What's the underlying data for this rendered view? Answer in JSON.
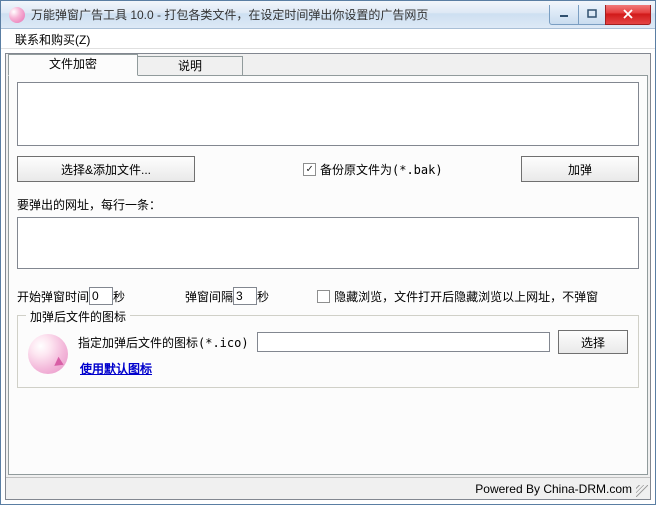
{
  "title": "万能弹窗广告工具 10.0 - 打包各类文件，在设定时间弹出你设置的广告网页",
  "menu": {
    "contact": "联系和购买(Z)"
  },
  "tabs": {
    "encrypt": "文件加密",
    "help": "说明"
  },
  "buttons": {
    "select_add": "选择&添加文件...",
    "encrypt": "加弹",
    "choose_icon": "选择"
  },
  "checkboxes": {
    "backup": {
      "label": "备份原文件为(*.bak)",
      "checked": true
    },
    "hidden_browse": {
      "label": "隐藏浏览，文件打开后隐藏浏览以上网址，不弹窗",
      "checked": false
    }
  },
  "labels": {
    "urls": "要弹出的网址，每行一条：",
    "start_time_pre": "开始弹窗时间",
    "seconds": "秒",
    "interval_pre": "弹窗间隔",
    "group_title": "加弹后文件的图标",
    "icon_spec": "指定加弹后文件的图标(*.ico)"
  },
  "inputs": {
    "top_text": "",
    "urls_text": "",
    "start_time": "0",
    "interval": "3",
    "icon_path": ""
  },
  "links": {
    "default_icon": "使用默认图标"
  },
  "status": "Powered By China-DRM.com"
}
